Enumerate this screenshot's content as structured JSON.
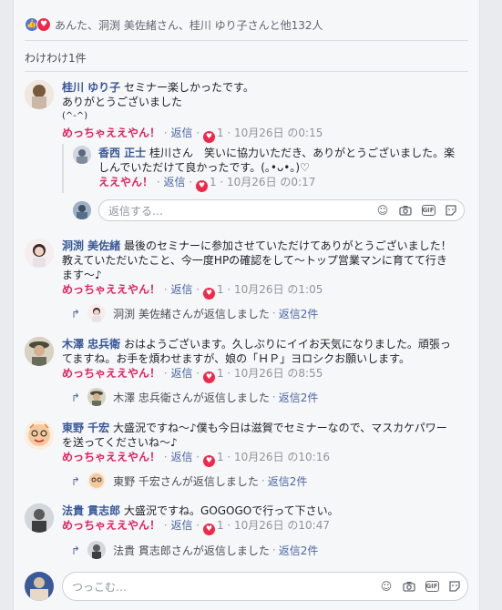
{
  "reactions": {
    "summary": "あんた、洞渕 美佐緒さん、桂川 ゆり子さんと他132人"
  },
  "shares": "わけわけ1件",
  "comments": [
    {
      "author": "桂川 ゆり子",
      "text": "セミナー楽しかったです。",
      "text2": "ありがとうございました",
      "text3": "(^-^)",
      "reaction_label": "めっちゃええやん！",
      "reply_label": "返信",
      "count": "1",
      "date": "10月26日 の0:15",
      "nested": {
        "author": "香西 正士",
        "text": "桂川さん　笑いに協力いただき、ありがとうございました。楽",
        "text2": "しんでいただけて良かったです。(｡•ᴗ•｡)♡",
        "reaction_label": "ええやん！",
        "reply_label": "返信",
        "count": "1",
        "date": "10月26日 の0:17"
      },
      "input_placeholder": "返信する…"
    },
    {
      "author": "洞渕 美佐緒",
      "text": "最後のセミナーに参加させていただけてありがとうございました！",
      "text2": "教えていただいたこと、今一度HPの確認をして～トップ営業マンに育てて行き",
      "text3": "ます～♪",
      "reaction_label": "めっちゃええやん！",
      "reply_label": "返信",
      "count": "1",
      "date": "10月26日 の1:05",
      "replies_by": "洞渕 美佐緒さんが返信しました",
      "replies_count": "返信2件"
    },
    {
      "author": "木澤 忠兵衛",
      "text": "おはようございます。久しぶりにイイお天気になりました。頑張っ",
      "text2": "てますね。お手を煩わせますが、娘の「ＨＰ」ヨロシクお願いします。",
      "reaction_label": "めっちゃええやん！",
      "reply_label": "返信",
      "count": "1",
      "date": "10月26日 の8:55",
      "replies_by": "木澤 忠兵衛さんが返信しました",
      "replies_count": "返信2件"
    },
    {
      "author": "東野 千宏",
      "text": "大盛況ですね～♪僕も今日は滋賀でセミナーなので、マスカケパワー",
      "text2": "を送ってくださいね～♪",
      "reaction_label": "めっちゃええやん！",
      "reply_label": "返信",
      "count": "1",
      "date": "10月26日 の10:16",
      "replies_by": "東野 千宏さんが返信しました",
      "replies_count": "返信2件"
    },
    {
      "author": "法貴 貫志郎",
      "text": "大盛況ですね。GOGOGOで行って下さい。",
      "reaction_label": "めっちゃええやん！",
      "reply_label": "返信",
      "count": "1",
      "date": "10月26日 の10:47",
      "replies_by": "法貴 貫志郎さんが返信しました",
      "replies_count": "返信2件"
    }
  ],
  "composer": {
    "placeholder": "つっこむ…"
  },
  "icons": [
    "like-icon",
    "love-icon",
    "heart-icon",
    "reply-arrow-icon",
    "emoji-icon",
    "camera-icon",
    "gif-icon",
    "sticker-icon"
  ],
  "colors": {
    "accent": "#385898",
    "reaction": "#e0245e",
    "love": "#f0284a",
    "like": "#4a76e8"
  }
}
